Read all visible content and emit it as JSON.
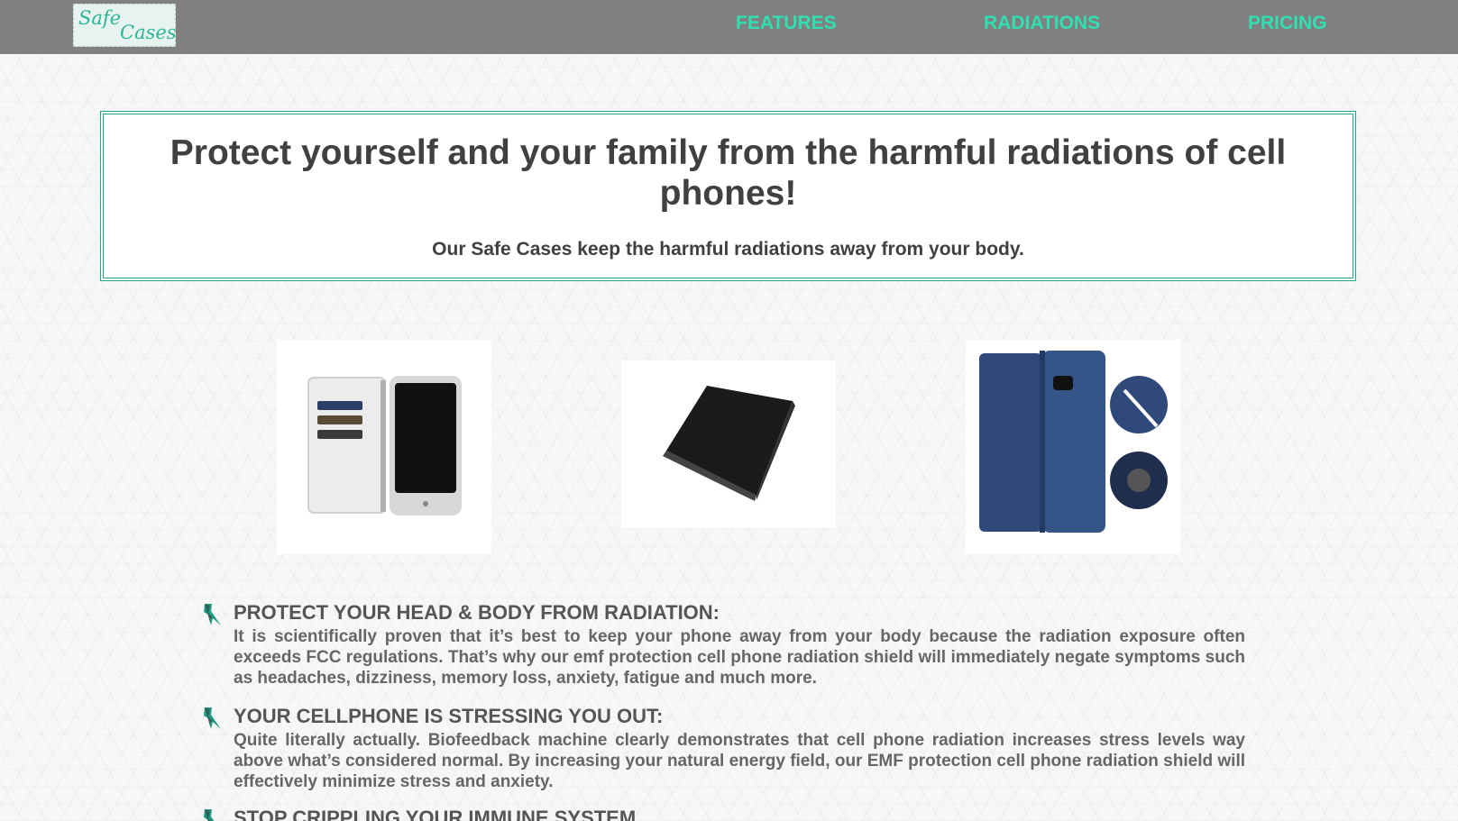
{
  "nav": {
    "logo_line1": "Safe",
    "logo_line2": "Cases",
    "links": [
      "FEATURES",
      "RADIATIONS",
      "PRICING"
    ]
  },
  "hero": {
    "title": "Protect yourself and your family from the harmful radiations of cell phones!",
    "subtitle": "Our Safe Cases keep the harmful radiations away from your body."
  },
  "colors": {
    "accent": "#2fe0b3",
    "border": "#1fa888",
    "navbar": "#808080",
    "heading_text": "#404040"
  },
  "features": [
    {
      "icon": "lightning-bolt-icon",
      "heading": "PROTECT YOUR HEAD & BODY FROM RADIATION:",
      "body": "It is scientifically proven that it’s best to keep your phone away from your body because the radiation exposure often exceeds FCC regulations. That’s why our emf protection cell phone radiation shield will immediately negate symptoms such as headaches, dizziness, memory loss, anxiety, fatigue and much more."
    },
    {
      "icon": "lightning-bolt-icon",
      "heading": "YOUR CELLPHONE IS STRESSING YOU OUT:",
      "body": "Quite literally actually. Biofeedback machine clearly demonstrates that cell phone radiation increases stress levels way above what’s considered normal. By increasing your natural energy field, our EMF protection cell phone radiation shield will effectively minimize stress and anxiety."
    },
    {
      "icon": "lightning-bolt-icon",
      "heading": "STOP CRIPPLING YOUR IMMUNE SYSTEM"
    }
  ]
}
